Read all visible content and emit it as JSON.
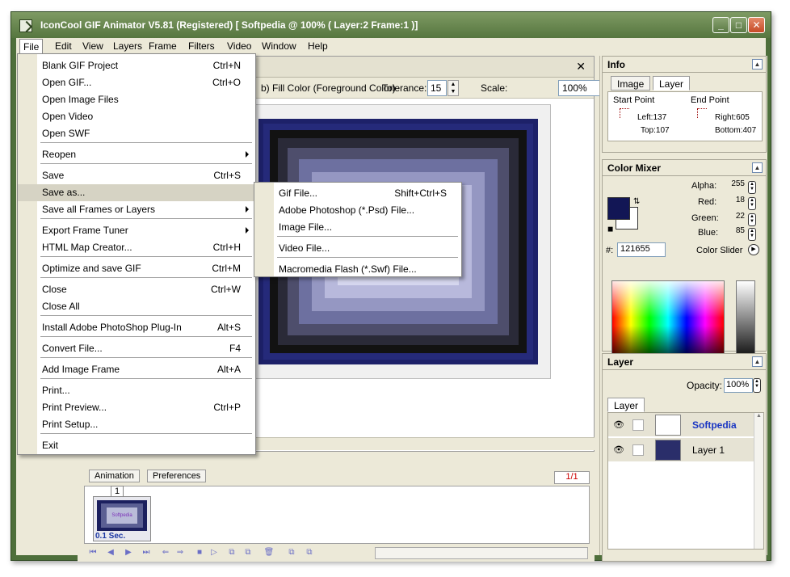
{
  "window": {
    "title": "IconCool GIF Animator V5.81 (Registered) [ Softpedia @ 100% ( Layer:2 Frame:1 )]",
    "min": "_",
    "max": "□",
    "close": "✕"
  },
  "menubar": [
    "File",
    "Edit",
    "View",
    "Layers",
    "Frame",
    "Filters",
    "Video",
    "Window",
    "Help"
  ],
  "file_menu": [
    {
      "label": "Blank GIF Project",
      "shortcut": "Ctrl+N"
    },
    {
      "label": "Open GIF...",
      "shortcut": "Ctrl+O"
    },
    {
      "label": "Open Image Files",
      "shortcut": ""
    },
    {
      "label": "Open Video",
      "shortcut": ""
    },
    {
      "label": "Open SWF",
      "shortcut": ""
    },
    {
      "label": "Reopen",
      "shortcut": ""
    },
    {
      "label": "Save",
      "shortcut": "Ctrl+S"
    },
    {
      "label": "Save as...",
      "shortcut": ""
    },
    {
      "label": "Save all Frames or Layers",
      "shortcut": ""
    },
    {
      "label": "Export Frame Tuner",
      "shortcut": ""
    },
    {
      "label": "HTML Map Creator...",
      "shortcut": "Ctrl+H"
    },
    {
      "label": "Optimize and save GIF",
      "shortcut": "Ctrl+M"
    },
    {
      "label": "Close",
      "shortcut": "Ctrl+W"
    },
    {
      "label": "Close All",
      "shortcut": ""
    },
    {
      "label": "Install Adobe PhotoShop Plug-In",
      "shortcut": "Alt+S"
    },
    {
      "label": "Convert File...",
      "shortcut": "F4"
    },
    {
      "label": "Add Image Frame",
      "shortcut": "Alt+A"
    },
    {
      "label": "Print...",
      "shortcut": ""
    },
    {
      "label": "Print Preview...",
      "shortcut": "Ctrl+P"
    },
    {
      "label": "Print Setup...",
      "shortcut": ""
    },
    {
      "label": "Exit",
      "shortcut": ""
    }
  ],
  "saveas_menu": [
    {
      "label": "Gif File...",
      "shortcut": "Shift+Ctrl+S"
    },
    {
      "label": "Adobe Photoshop (*.Psd) File...",
      "shortcut": ""
    },
    {
      "label": "Image File...",
      "shortcut": ""
    },
    {
      "label": "Video File...",
      "shortcut": ""
    },
    {
      "label": "Macromedia Flash (*.Swf) File...",
      "shortcut": ""
    }
  ],
  "toolopts": {
    "partial": "b)",
    "fill_color": "Fill Color (Foreground Color)",
    "tolerance_label": "Tolerance:",
    "tolerance_value": "15",
    "scale_label": "Scale:",
    "scale_value": "100%"
  },
  "timeline": {
    "tab1": "Animation",
    "tab2": "Preferences",
    "page": "1/1",
    "frame_number": "1",
    "frame_delay": "0.1 Sec.",
    "thumb_text": "Softpedia"
  },
  "info": {
    "title": "Info",
    "tab_image": "Image",
    "tab_layer": "Layer",
    "start_point": "Start Point",
    "end_point": "End Point",
    "left": "Left:137",
    "top": "Top:107",
    "right": "Right:605",
    "bottom": "Bottom:407"
  },
  "color_mixer": {
    "title": "Color Mixer",
    "alpha_label": "Alpha:",
    "alpha": "255",
    "red_label": "Red:",
    "red": "18",
    "green_label": "Green:",
    "green": "22",
    "blue_label": "Blue:",
    "blue": "85",
    "hex_label": "#:",
    "hex": "121655",
    "slider_label": "Color Slider",
    "swatch_color": "#121655"
  },
  "layer_panel": {
    "title": "Layer",
    "opacity_label": "Opacity:",
    "opacity": "100%",
    "tab": "Layer",
    "layers": [
      "Softpedia",
      "Layer 1"
    ]
  }
}
